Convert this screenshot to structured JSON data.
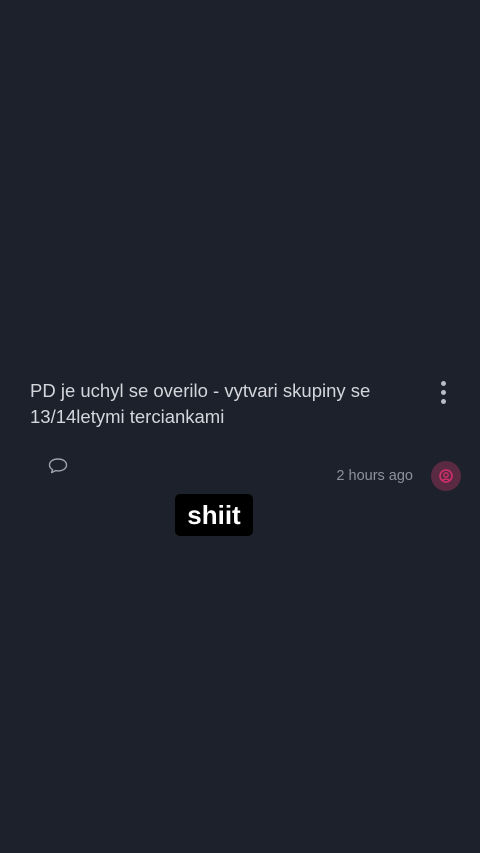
{
  "post": {
    "title": "PD je uchyl se overilo - vytvari skupiny se 13/14letymi terciankami",
    "timestamp": "2 hours ago",
    "icons": {
      "more": "more-vertical-icon",
      "comment": "comment-icon",
      "avatar": "avatar-icon"
    }
  },
  "overlay": {
    "caption": "shiit"
  },
  "colors": {
    "background": "#1d212c",
    "title_text": "#d4d6dc",
    "muted_text": "#8d919b",
    "avatar_bg": "#5a2a42",
    "avatar_fg": "#d0306a",
    "caption_bg": "#000000",
    "caption_text": "#ffffff"
  }
}
